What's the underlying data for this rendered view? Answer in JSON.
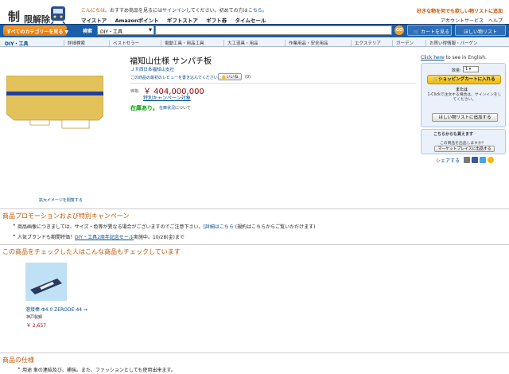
{
  "header": {
    "logo_text_1": "制",
    "logo_text_2": "限解除",
    "greeting": "こんにちは。",
    "greeting_rest": "おすすめ商品を見るには",
    "signin_link": "サインイン",
    "greeting_tail": "してください。初めての方は",
    "here_link": "こちら",
    "nav": [
      "マイストア",
      "Amazonポイント",
      "ギフトストア",
      "ギフト券",
      "タイムセール"
    ],
    "promo_right": "好きな物を何でも欲しい物リストに追加",
    "account_links": [
      "アカウントサービス",
      "ヘルプ"
    ]
  },
  "search": {
    "all_categories": "すべてのカテゴリーを見る",
    "label": "検索",
    "category_value": "DIY・工具",
    "query": "",
    "go": "GO",
    "cart": "カートを見る",
    "wishlist": "ほしい物リスト"
  },
  "subnav": {
    "home": "DIY・工具",
    "items": [
      "詳細検索",
      "ベストセラー",
      "電動工具・用品工具",
      "大工道具・用品",
      "作業用品・安全用品",
      "エクステリア",
      "ガーデン",
      "お買い得情報・バーゲン"
    ]
  },
  "product": {
    "title": "福知山仕様 サンパチ板",
    "brand": "ＪＲ西日本福知山支社",
    "review_prompt": "この商品の最初のレビューを書き込んでください。",
    "like_label": "いいね",
    "like_count": "(0)",
    "price_label": "価格:",
    "price": "￥ 404,000,000",
    "campaign_link": "特別キャンペーン対象",
    "stock": "在庫あり。",
    "stock_link": "在庫状況",
    "stock_suffix": "について",
    "image_caption": "拡大イメージを閲覧する"
  },
  "buybox": {
    "english_link": "Click here",
    "english_text": " to see in English.",
    "qty_label": "数量:",
    "qty_value": "1",
    "add_to_cart": "ショッピングカートに入れる",
    "or": "または",
    "oneclick_text": "1-Clickで注文する場合は、サインインをしてください。",
    "add_to_wishlist": "ほしい物リストに追加する"
  },
  "sellbox": {
    "heading": "こちらからも買えます",
    "question": "この商品を出品しますか？",
    "button": "マーケットプレイスに出品する"
  },
  "share": {
    "label": "シェアする"
  },
  "promo_section": {
    "title": "商品プロモーションおよび特別キャンペーン",
    "line1": "商品画像につきましては、サイズ・色等が異なる場合がございますのでご注意下さい。",
    "line1_link": "[詳細はこちら",
    "line1_tail": " (規約はこちらからご覧いただけます)",
    "line2_pre": "人気ブランドも期間特価！",
    "line2_link": "DIY・工具2周年記念セール",
    "line2_tail": "実施中。10/28(金)まで"
  },
  "related_section": {
    "title": "この商品をチェックした人はこんな商品もチェックしています",
    "item_name": "溶接棒 Φ4.0 ZERODE-44 ⇒",
    "item_brand": "神戸製鋼",
    "item_price": "￥ 2,657"
  },
  "spec_section": {
    "title": "商品の仕様",
    "line1": "用途 車の連結及び、補強。また、ファッションとしても使用出来ます。"
  },
  "colors": {
    "search_bar": "#1a5fa8",
    "price_red": "#990000",
    "section_orange": "#c45500",
    "stock_green": "#009900",
    "board_yellow": "#e3c25c",
    "board_stripe": "#1f3fa0"
  }
}
